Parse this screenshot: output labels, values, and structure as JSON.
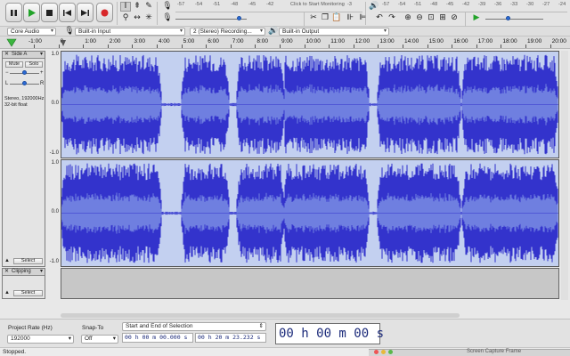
{
  "toolbar": {
    "transport": [
      "pause-icon",
      "play-icon",
      "stop-icon",
      "skip-start-icon",
      "skip-end-icon",
      "record-icon"
    ],
    "rec_meter_scale": "-57  -54  -51  -48  -45  -42   Click to Start Monitoring  !1  -18  -15  -12   -9   -6   -3   0",
    "play_meter_scale": "-57  -54  -51  -48  -45  -42  -39  -36  -33  -30  -27  -24  -21  -18  -15  -12   -9   -6   -3   0",
    "monitor_label": "Click to Start Monitoring"
  },
  "devices": {
    "host": "Core Audio",
    "input": "Built-in Input",
    "channels": "2 (Stereo) Recording...",
    "output": "Built-in Output"
  },
  "ruler": {
    "ticks": [
      "-1:00",
      "0",
      "1:00",
      "2:00",
      "3:00",
      "4:00",
      "5:00",
      "6:00",
      "7:00",
      "8:00",
      "9:00",
      "10:00",
      "11:00",
      "12:00",
      "13:00",
      "14:00",
      "15:00",
      "16:00",
      "17:00",
      "18:00",
      "19:00",
      "20:00"
    ]
  },
  "track1": {
    "name": "Side A",
    "mute": "Mute",
    "solo": "Solo",
    "info": "Stereo, 192000Hz\n32-bit float",
    "select": "Select",
    "scale": [
      "1.0",
      "0.0",
      "-1.0"
    ],
    "scale2": [
      "1.0",
      "0.0",
      "-1.0"
    ]
  },
  "track2": {
    "name": "Clipping",
    "select": "Select"
  },
  "bottom": {
    "project_rate_label": "Project Rate (Hz)",
    "project_rate": "192000",
    "snap_label": "Snap-To",
    "snap_value": "Off",
    "selection_mode": "Start and End of Selection",
    "sel_start": "00 h 00 m 00.000 s",
    "sel_end": "00 h 20 m 23.232 s",
    "audio_position": "00 h 00 m 00 s"
  },
  "status": "Stopped.",
  "overlay_text": "Screen Capture Frame"
}
